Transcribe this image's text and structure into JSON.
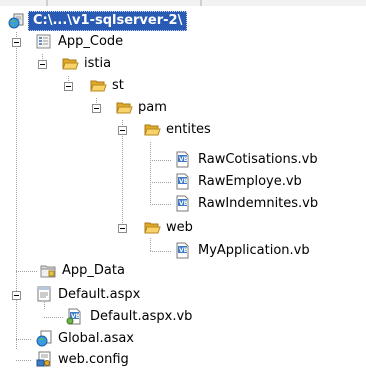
{
  "solution_explorer": {
    "root": {
      "label": "C:\\...\\v1-sqlserver-2\\",
      "icon": "project-globe-icon"
    },
    "items": [
      {
        "label": "App_Code",
        "icon": "special-folder-icon"
      },
      {
        "label": "istia",
        "icon": "folder-open-icon"
      },
      {
        "label": "st",
        "icon": "folder-open-icon"
      },
      {
        "label": "pam",
        "icon": "folder-open-icon"
      },
      {
        "label": "entites",
        "icon": "folder-open-icon"
      },
      {
        "label": "RawCotisations.vb",
        "icon": "vb-file-icon"
      },
      {
        "label": "RawEmploye.vb",
        "icon": "vb-file-icon"
      },
      {
        "label": "RawIndemnites.vb",
        "icon": "vb-file-icon"
      },
      {
        "label": "web",
        "icon": "folder-open-icon"
      },
      {
        "label": "MyApplication.vb",
        "icon": "vb-file-icon"
      },
      {
        "label": "App_Data",
        "icon": "data-folder-icon"
      },
      {
        "label": "Default.aspx",
        "icon": "aspx-page-icon"
      },
      {
        "label": "Default.aspx.vb",
        "icon": "vb-codebehind-icon"
      },
      {
        "label": "Global.asax",
        "icon": "global-asax-icon"
      },
      {
        "label": "web.config",
        "icon": "config-file-icon"
      }
    ]
  },
  "colors": {
    "selection_bg": "#2a5bb4",
    "folder_yellow": "#f5c542",
    "tree_lines": "#a0a0a0"
  }
}
